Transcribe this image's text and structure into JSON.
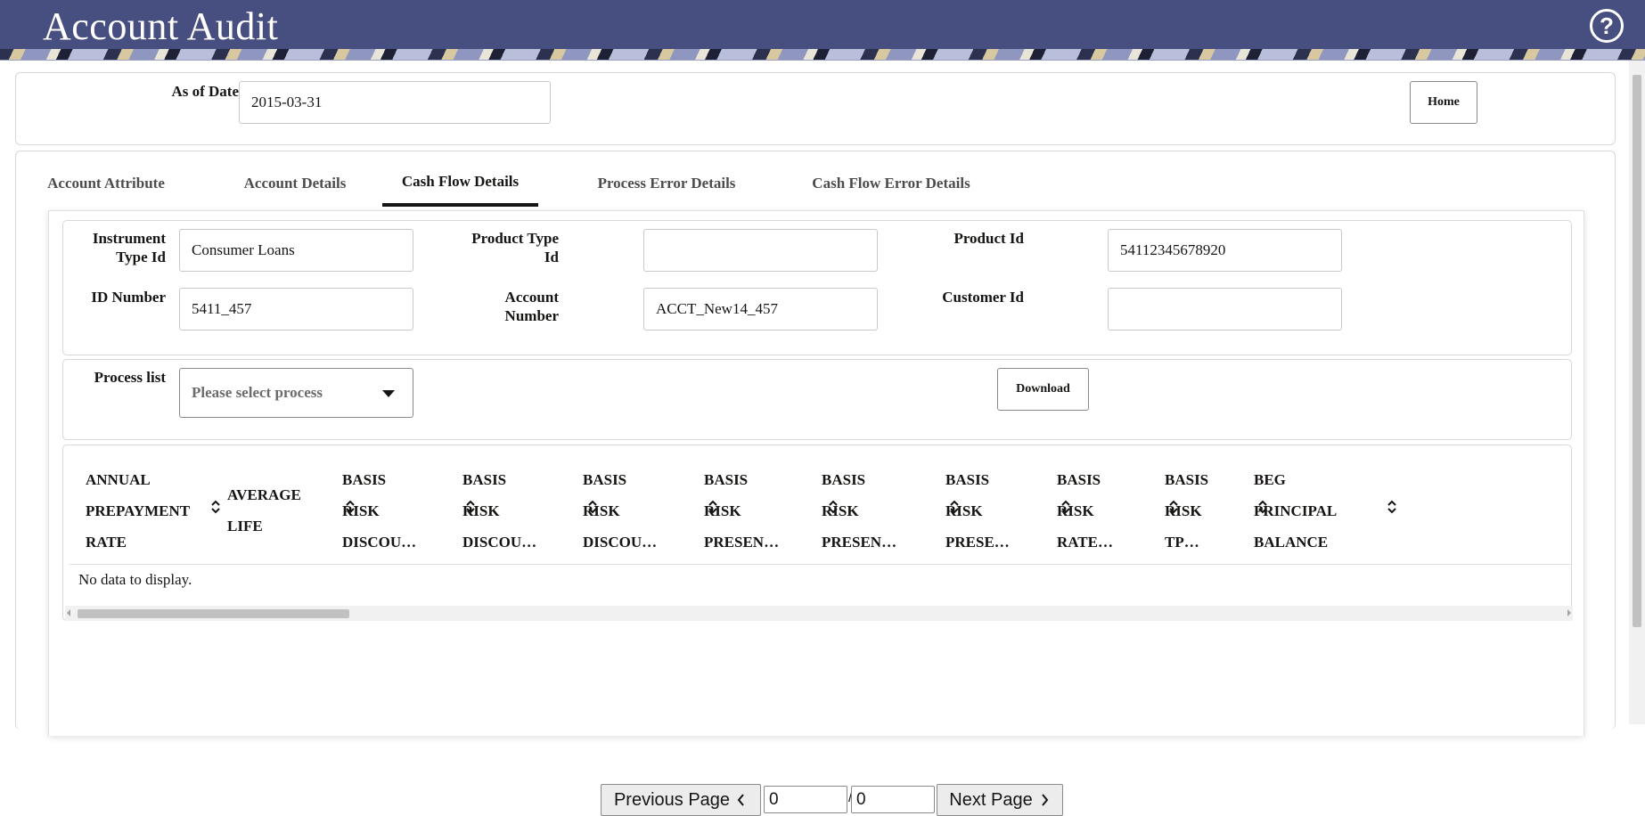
{
  "header": {
    "title": "Account Audit",
    "help_icon": "question-circle-icon"
  },
  "filters": {
    "as_of_date_label": "As of Date",
    "as_of_date_value": "2015-03-31",
    "home_label": "Home"
  },
  "tabs": [
    {
      "label": "Account Attribute",
      "active": false
    },
    {
      "label": "Account Details",
      "active": false
    },
    {
      "label": "Cash Flow Details",
      "active": true
    },
    {
      "label": "Process Error Details",
      "active": false
    },
    {
      "label": "Cash Flow Error Details",
      "active": false
    }
  ],
  "details": {
    "instrument_type_id_label": [
      "Instrument",
      "Type Id"
    ],
    "instrument_type_id_value": "Consumer Loans",
    "product_type_id_label": [
      "Product Type",
      "Id"
    ],
    "product_type_id_value": "",
    "product_id_label": "Product Id",
    "product_id_value": "54112345678920",
    "id_number_label": "ID Number",
    "id_number_value": "5411_457",
    "account_number_label": [
      "Account",
      "Number"
    ],
    "account_number_value": "ACCT_New14_457",
    "customer_id_label": "Customer Id",
    "customer_id_value": ""
  },
  "process": {
    "label": "Process list",
    "placeholder": "Please select process",
    "download_label": "Download"
  },
  "table": {
    "columns": [
      [
        "ANNUAL",
        "PREPAYMENT",
        "RATE"
      ],
      [
        "AVERAGE",
        "LIFE"
      ],
      [
        "BASIS",
        "RISK",
        "DISCOU…"
      ],
      [
        "BASIS",
        "RISK",
        "DISCOU…"
      ],
      [
        "BASIS",
        "RISK",
        "DISCOU…"
      ],
      [
        "BASIS",
        "RISK",
        "PRESEN…"
      ],
      [
        "BASIS",
        "RISK",
        "PRESEN…"
      ],
      [
        "BASIS",
        "RISK",
        "PRESE…"
      ],
      [
        "BASIS",
        "RISK",
        "RATE…"
      ],
      [
        "BASIS",
        "RISK",
        "TP…"
      ],
      [
        "BEG",
        "PRINCIPAL",
        "BALANCE"
      ]
    ],
    "empty_message": "No data to display."
  },
  "pager": {
    "previous_label": "Previous Page",
    "next_label": "Next Page",
    "current_page": "0",
    "separator": "/",
    "total_pages": "0"
  }
}
